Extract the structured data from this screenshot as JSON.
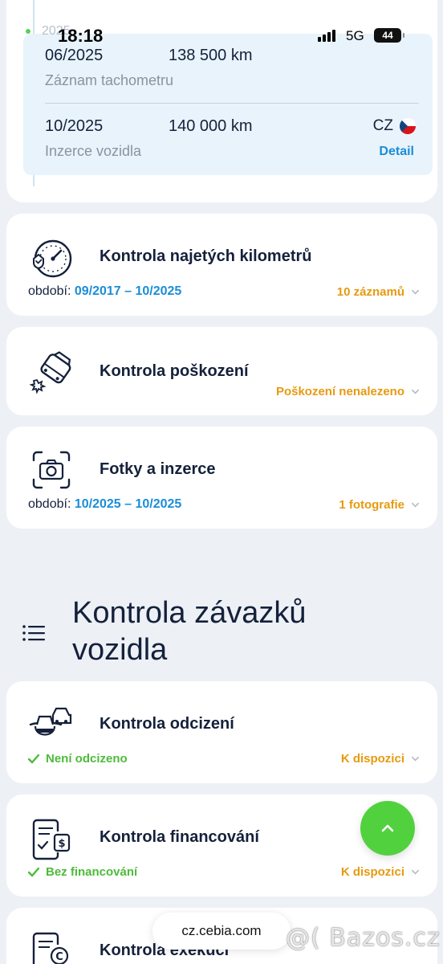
{
  "status_bar": {
    "time": "18:18",
    "ghost_year": "2025",
    "network": "5G",
    "battery": "44"
  },
  "timeline": {
    "records": [
      {
        "date": "06/2025",
        "km": "138 500 km",
        "type": "Záznam tachometru"
      },
      {
        "date": "10/2025",
        "km": "140 000 km",
        "type": "Inzerce vozidla",
        "country": "CZ",
        "link": "Detail"
      }
    ]
  },
  "checks": [
    {
      "title": "Kontrola najetých kilometrů",
      "period_label": "období:",
      "period_value": "09/2017 – 10/2025",
      "status": "10 záznamů",
      "icon": "speedometer-icon"
    },
    {
      "title": "Kontrola poškození",
      "status": "Poškození nenalezeno",
      "icon": "damaged-car-icon"
    },
    {
      "title": "Fotky a inzerce",
      "period_label": "období:",
      "period_value": "10/2025 – 10/2025",
      "status": "1 fotografie",
      "icon": "camera-icon"
    }
  ],
  "section": {
    "title": "Kontrola závazků vozidla"
  },
  "obligations": [
    {
      "title": "Kontrola odcizení",
      "result": "Není odcizeno",
      "status": "K dispozici",
      "icon": "thief-car-icon"
    },
    {
      "title": "Kontrola financování",
      "result": "Bez financování",
      "status": "K dispozici",
      "icon": "finance-document-icon"
    },
    {
      "title": "Kontrola exekucí",
      "icon": "execution-document-icon"
    }
  ],
  "browser": {
    "url": "cz.cebia.com"
  },
  "watermark": "@( Bazos.cz",
  "colors": {
    "accent_blue": "#1a8dd8",
    "accent_orange": "#e69a10",
    "success_green": "#4dbb3a",
    "fab_green": "#52d13f",
    "navy": "#15213b"
  }
}
